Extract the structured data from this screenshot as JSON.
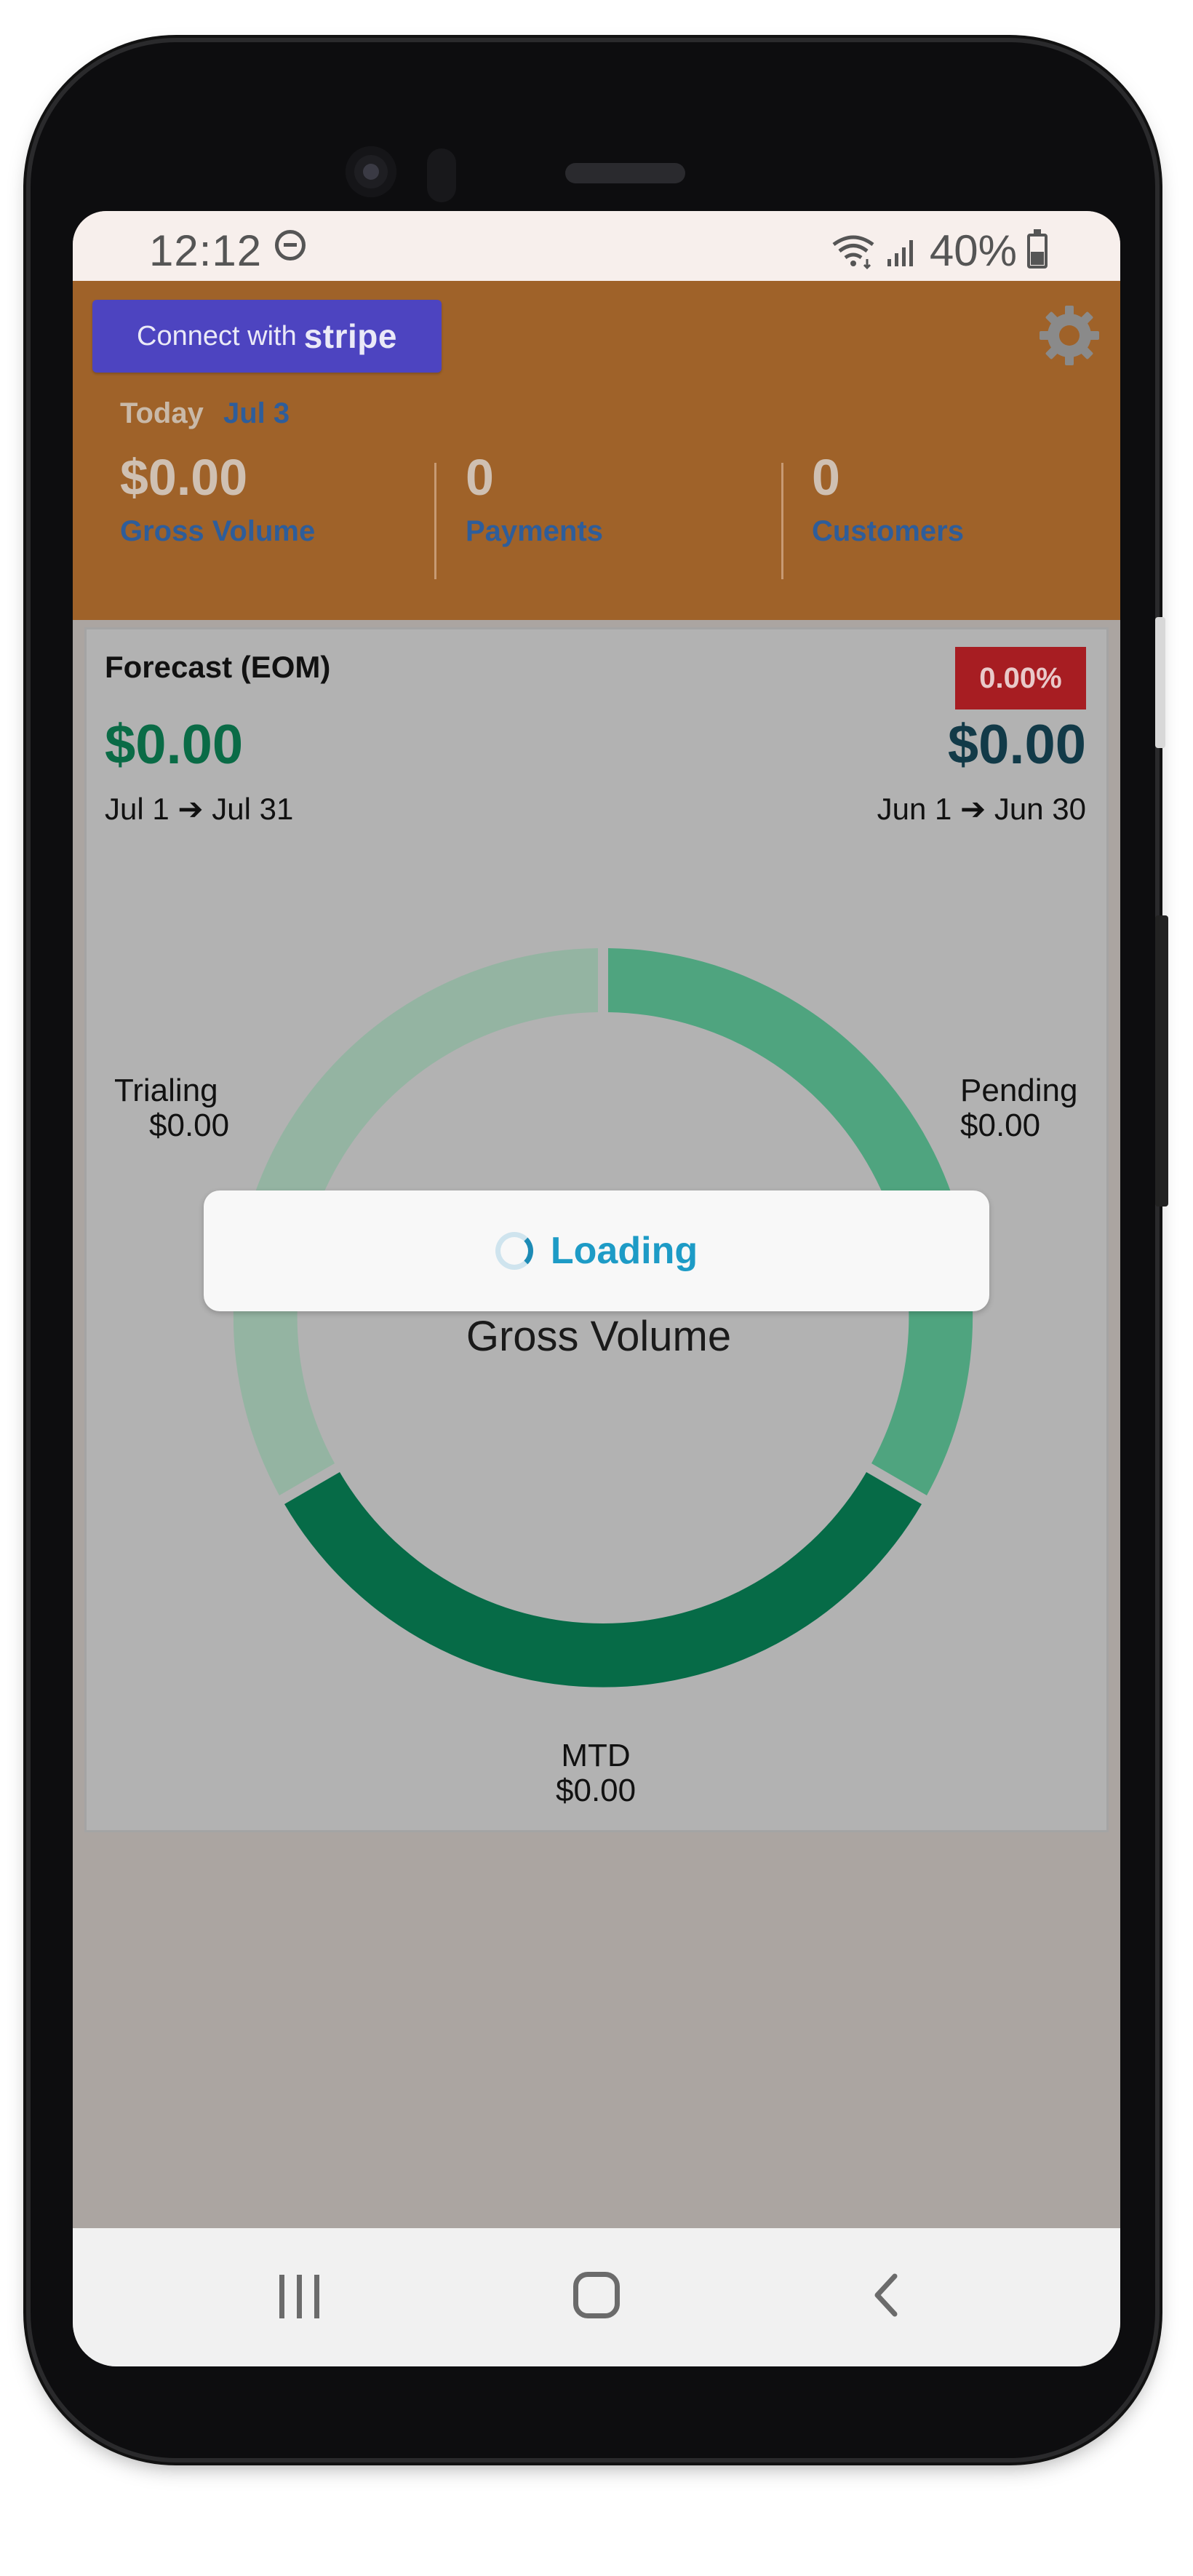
{
  "status_bar": {
    "time": "12:12",
    "battery_percent": "40%"
  },
  "header": {
    "connect_button": {
      "prefix": "Connect with",
      "brand": "stripe"
    },
    "today_label": "Today",
    "today_date": "Jul 3",
    "stats": [
      {
        "value": "$0.00",
        "label": "Gross Volume"
      },
      {
        "value": "0",
        "label": "Payments"
      },
      {
        "value": "0",
        "label": "Customers"
      }
    ]
  },
  "forecast": {
    "title": "Forecast (EOM)",
    "change_badge": "0.00%",
    "current_amount": "$0.00",
    "current_range": "Jul 1 ➔ Jul 31",
    "previous_amount": "$0.00",
    "previous_range": "Jun 1 ➔ Jun 30",
    "center_label": "Gross Volume",
    "segments": [
      {
        "name": "Trialing",
        "value": "$0.00",
        "color": "#94b4a2"
      },
      {
        "name": "Pending",
        "value": "$0.00",
        "color": "#4fa47f"
      },
      {
        "name": "MTD",
        "value": "$0.00",
        "color": "#066b47"
      }
    ]
  },
  "loading": {
    "text": "Loading"
  },
  "colors": {
    "header_bg": "#9f6229",
    "stripe_button": "#4d44c0",
    "badge_red": "#a71d22",
    "accent_blue": "#2e5d9a",
    "positive_green": "#0a6b46"
  },
  "icons": {
    "settings": "gear-icon",
    "nav_recents": "recents-icon",
    "nav_home": "home-icon",
    "nav_back": "back-icon"
  }
}
